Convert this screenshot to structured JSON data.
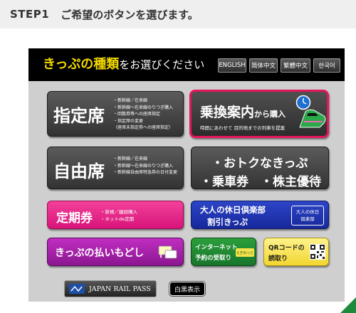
{
  "step": {
    "number": "STEP1",
    "text": "ご希望のボタンを選びます。"
  },
  "topbar": {
    "title_highlight": "きっぷの種類",
    "title_rest": "をお選びください",
    "languages": [
      "ENGLISH",
      "简体中文",
      "繁體中文",
      "한국어"
    ]
  },
  "buttons": {
    "reserved": {
      "label": "指定席",
      "notes": [
        "・新幹線／在来線",
        "・新幹線〜在来線のりつぎ購入",
        "・回数券等への座席指定",
        "・指定席の変更",
        "（座席未指定券への座席指定）"
      ]
    },
    "transfer": {
      "label_main": "乗換案内",
      "label_small": "から購入",
      "sub": "時間にあわせて 目的地までの列車を提案"
    },
    "unreserved": {
      "label": "自由席",
      "notes": [
        "・新幹線／在来線",
        "・新幹線〜在来線のりつぎ購入",
        "・新幹線自由席特急券の日付変更"
      ]
    },
    "otoku": {
      "line1": "・おトクなきっぷ",
      "line2": "・乗車券　・株主優待"
    },
    "commuter": {
      "label": "定期券",
      "notes": [
        "・新規／継続購入",
        "・ネットde定期"
      ]
    },
    "holiday": {
      "line1": "大人の休日倶楽部",
      "line2": "割引きっぷ",
      "badge_line1": "大人の休日",
      "badge_line2": "倶楽部"
    },
    "refund": {
      "label": "きっぷの払いもどし"
    },
    "internet": {
      "line1": "インターネット",
      "line2": "予約の受取り",
      "badge": "えきねっと"
    },
    "qr": {
      "line1": "QRコードの",
      "line2": "読取り"
    }
  },
  "bottom": {
    "jrpass": "JAPAN RAIL PASS",
    "bw": "白黒表示"
  },
  "colors": {
    "accent_pink": "#e4155b",
    "title_yellow": "#f3d900",
    "topbar": "#000000"
  }
}
